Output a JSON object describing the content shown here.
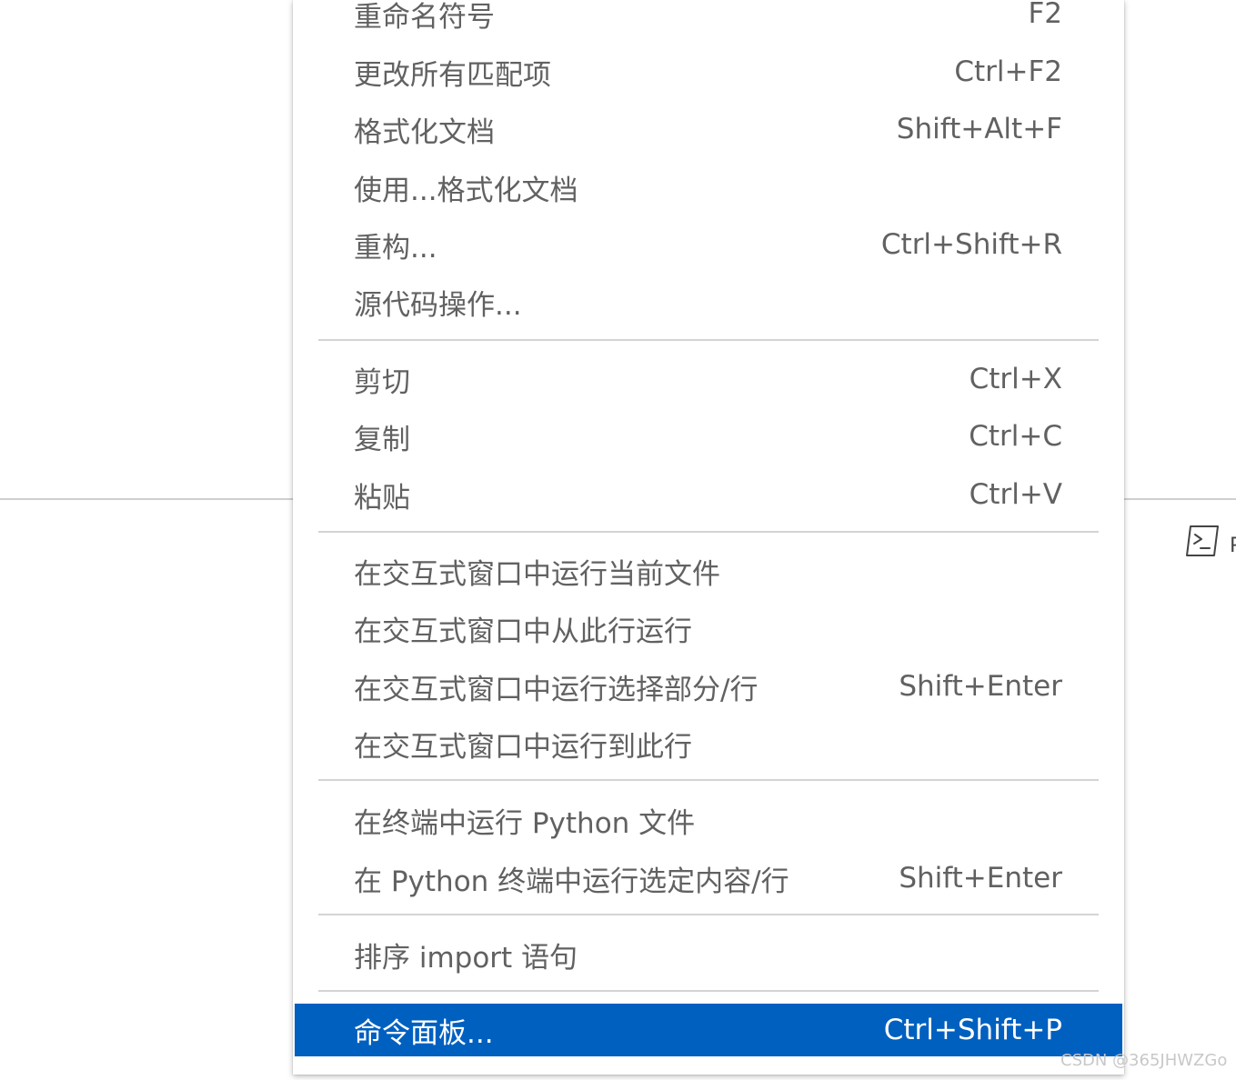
{
  "menu": {
    "group1": [
      {
        "label": "重命名符号",
        "shortcut": "F2"
      },
      {
        "label": "更改所有匹配项",
        "shortcut": "Ctrl+F2"
      },
      {
        "label": "格式化文档",
        "shortcut": "Shift+Alt+F"
      },
      {
        "label": "使用...格式化文档",
        "shortcut": ""
      },
      {
        "label": "重构...",
        "shortcut": "Ctrl+Shift+R"
      },
      {
        "label": "源代码操作...",
        "shortcut": ""
      }
    ],
    "group2": [
      {
        "label": "剪切",
        "shortcut": "Ctrl+X"
      },
      {
        "label": "复制",
        "shortcut": "Ctrl+C"
      },
      {
        "label": "粘贴",
        "shortcut": "Ctrl+V"
      }
    ],
    "group3": [
      {
        "label": "在交互式窗口中运行当前文件",
        "shortcut": ""
      },
      {
        "label": "在交互式窗口中从此行运行",
        "shortcut": ""
      },
      {
        "label": "在交互式窗口中运行选择部分/行",
        "shortcut": "Shift+Enter"
      },
      {
        "label": "在交互式窗口中运行到此行",
        "shortcut": ""
      }
    ],
    "group4": [
      {
        "label": "在终端中运行 Python 文件",
        "shortcut": ""
      },
      {
        "label": "在 Python 终端中运行选定内容/行",
        "shortcut": "Shift+Enter"
      }
    ],
    "group5": [
      {
        "label": "排序 import 语句",
        "shortcut": ""
      }
    ],
    "group6": [
      {
        "label": "命令面板...",
        "shortcut": "Ctrl+Shift+P"
      }
    ]
  },
  "colors": {
    "highlight": "#0060c0",
    "menu_text": "#616161",
    "separator": "#d4d4d4"
  },
  "background_panel": {
    "terminal_icon": "terminal-icon",
    "truncated_label": "P"
  },
  "watermark": "CSDN @365JHWZGo"
}
